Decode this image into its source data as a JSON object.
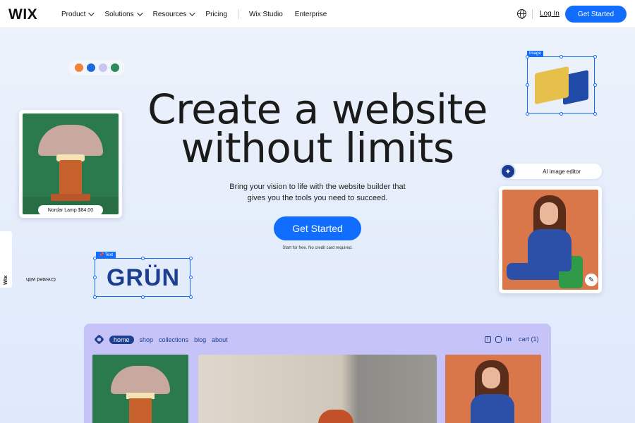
{
  "nav": {
    "logo": "WIX",
    "links": [
      {
        "label": "Product",
        "dropdown": true
      },
      {
        "label": "Solutions",
        "dropdown": true
      },
      {
        "label": "Resources",
        "dropdown": true
      },
      {
        "label": "Pricing",
        "dropdown": false
      }
    ],
    "links_right": [
      "Wix Studio",
      "Enterprise"
    ],
    "login": "Log In",
    "cta": "Get Started",
    "icons": [
      "globe-icon"
    ]
  },
  "hero": {
    "title_line1": "Create a website",
    "title_line2": "without limits",
    "subtitle_line1": "Bring your vision to life with the website builder that",
    "subtitle_line2": "gives you the tools you need to succeed.",
    "cta": "Get Started",
    "note": "Start for free. No credit card required."
  },
  "palette": [
    "#f2813b",
    "#1a6be0",
    "#c9c6f7",
    "#2d8a5a"
  ],
  "lamp_card": {
    "label": "Nordar Lamp $84.00"
  },
  "image_box": {
    "tag": "Image"
  },
  "ai_editor": {
    "icon": "sparkle-icon",
    "label": "AI image editor"
  },
  "text_box": {
    "tag": "Text",
    "content": "GRÜN"
  },
  "side_tab": {
    "prefix": "Created with",
    "brand": "Wix"
  },
  "preview": {
    "nav": [
      "home",
      "shop",
      "collections",
      "blog",
      "about"
    ],
    "social": [
      "facebook-icon",
      "instagram-icon",
      "linkedin-icon"
    ],
    "linkedin_text": "in",
    "cart": "cart (1)"
  },
  "colors": {
    "accent": "#116dff",
    "preview_bg": "#c6c3f8",
    "brand_navy": "#1c3f8f"
  }
}
